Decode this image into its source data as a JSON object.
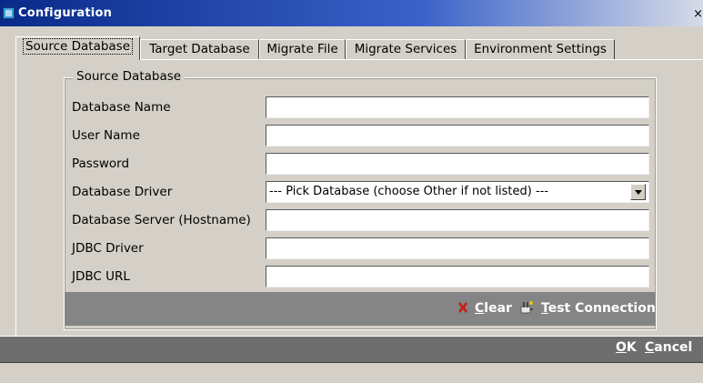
{
  "window": {
    "title": "Configuration",
    "close_glyph": "×"
  },
  "tabs": [
    {
      "label": "Source Database",
      "active": true
    },
    {
      "label": "Target Database",
      "active": false
    },
    {
      "label": "Migrate File",
      "active": false
    },
    {
      "label": "Migrate Services",
      "active": false
    },
    {
      "label": "Environment Settings",
      "active": false
    }
  ],
  "group": {
    "title": "Source Database"
  },
  "fields": [
    {
      "label": "Database Name",
      "value": ""
    },
    {
      "label": "User Name",
      "value": ""
    },
    {
      "label": "Password",
      "value": ""
    },
    {
      "label": "Database Driver",
      "value": "--- Pick Database (choose Other if not listed) ---"
    },
    {
      "label": "Database Server (Hostname)",
      "value": ""
    },
    {
      "label": "JDBC Driver",
      "value": ""
    },
    {
      "label": "JDBC URL",
      "value": ""
    }
  ],
  "actions": {
    "clear_mnemonic": "C",
    "clear_rest": "lear",
    "test_mnemonic": "T",
    "test_rest": "est Connection"
  },
  "dialog_buttons": {
    "ok_mnemonic": "O",
    "ok_rest": "K",
    "cancel_mnemonic": "C",
    "cancel_rest": "ancel"
  },
  "colors": {
    "title_gradient_start": "#0a2a8a",
    "panel_bg": "#d4d0c8",
    "action_bar_bg": "#858585",
    "bottom_bar_bg": "#6e6e6e",
    "clear_icon": "#c8201a"
  }
}
